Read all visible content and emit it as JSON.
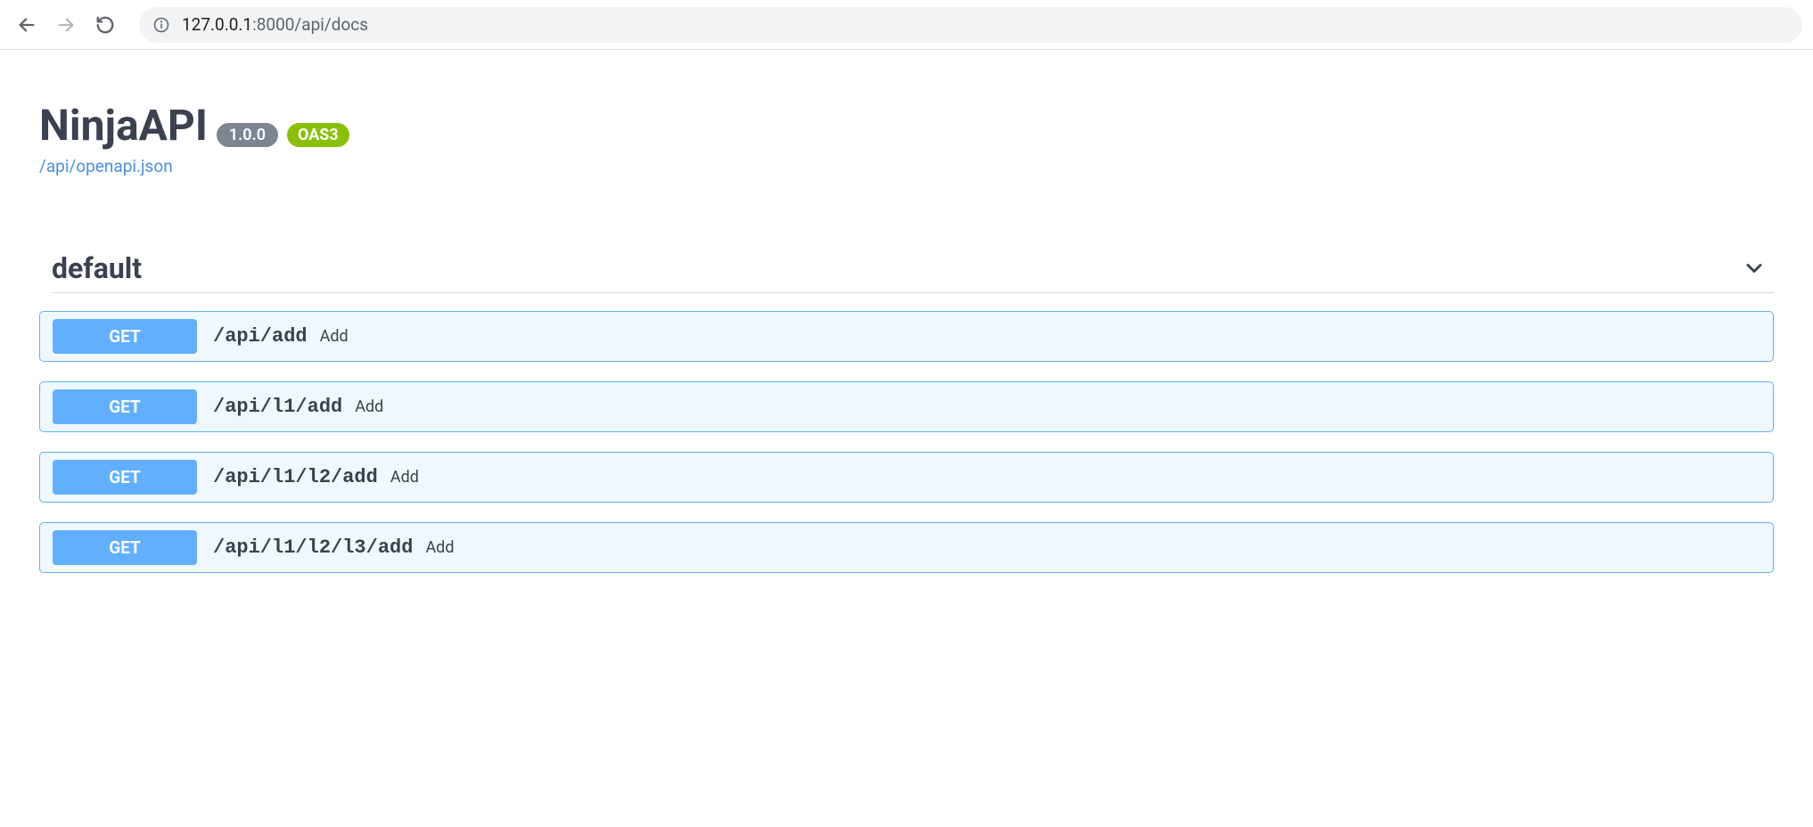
{
  "browser": {
    "url_host": "127.0.0.1",
    "url_path": ":8000/api/docs"
  },
  "api": {
    "title": "NinjaAPI",
    "version": "1.0.0",
    "oas_version": "OAS3",
    "openapi_link": "/api/openapi.json"
  },
  "tag": {
    "name": "default"
  },
  "operations": [
    {
      "method": "GET",
      "path": "/api/add",
      "summary": "Add"
    },
    {
      "method": "GET",
      "path": "/api/l1/add",
      "summary": "Add"
    },
    {
      "method": "GET",
      "path": "/api/l1/l2/add",
      "summary": "Add"
    },
    {
      "method": "GET",
      "path": "/api/l1/l2/l3/add",
      "summary": "Add"
    }
  ]
}
